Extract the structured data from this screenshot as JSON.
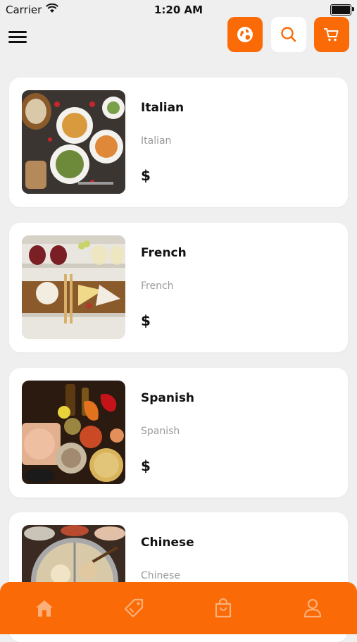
{
  "status_bar": {
    "carrier": "Carrier",
    "time": "1:20 AM"
  },
  "header": {
    "menu_icon": "hamburger-menu-icon",
    "buttons": [
      {
        "icon": "globe-icon",
        "style": "orange"
      },
      {
        "icon": "search-icon",
        "style": "white"
      },
      {
        "icon": "cart-icon",
        "style": "orange"
      }
    ]
  },
  "cuisines": [
    {
      "title": "Italian",
      "subtitle": "Italian",
      "price": "$"
    },
    {
      "title": "French",
      "subtitle": "French",
      "price": "$"
    },
    {
      "title": "Spanish",
      "subtitle": "Spanish",
      "price": "$"
    },
    {
      "title": "Chinese",
      "subtitle": "Chinese",
      "price": "$"
    }
  ],
  "bottom_nav": {
    "items": [
      {
        "icon": "home-icon"
      },
      {
        "icon": "tag-icon"
      },
      {
        "icon": "shopping-bag-icon"
      },
      {
        "icon": "profile-icon"
      }
    ]
  },
  "colors": {
    "accent": "#fa6b07",
    "background": "#efefef",
    "card": "#ffffff"
  }
}
